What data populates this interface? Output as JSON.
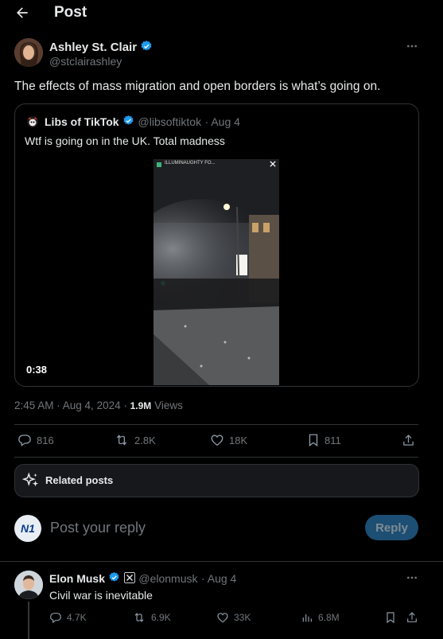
{
  "header": {
    "title": "Post"
  },
  "post": {
    "author_name": "Ashley St. Clair",
    "author_handle": "@stclairashley",
    "text": "The effects of mass migration and open borders is what’s going on.",
    "timestamp": "2:45 AM · Aug 4, 2024 ·",
    "views_count": "1.9M",
    "views_label": "Views"
  },
  "quoted": {
    "author_name": "Libs of TikTok",
    "author_handle": "@libsoftiktok",
    "date": "· Aug 4",
    "text": "Wtf is going on in the UK. Total madness",
    "video_overlay_label": "ILLUMINAUGHTY FO...",
    "video_duration": "0:38"
  },
  "actions": {
    "replies": "816",
    "reposts": "2.8K",
    "likes": "18K",
    "bookmarks": "811"
  },
  "related": {
    "label": "Related posts"
  },
  "composer": {
    "placeholder": "Post your reply",
    "reply_label": "Reply",
    "avatar_text": "N1"
  },
  "reply": {
    "author_name": "Elon Musk",
    "author_handle": "@elonmusk",
    "date": "· Aug 4",
    "text": "Civil war is inevitable",
    "replies": "4.7K",
    "reposts": "6.9K",
    "likes": "33K",
    "views": "6.8M"
  },
  "colors": {
    "accent": "#1d9bf0",
    "background": "#000000",
    "border": "#2f3336",
    "muted": "#71767b"
  }
}
